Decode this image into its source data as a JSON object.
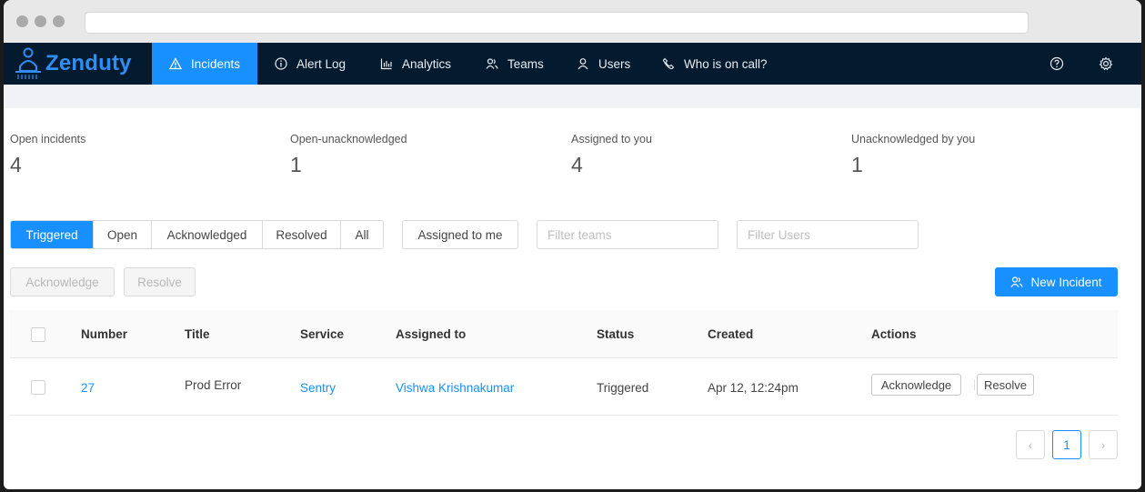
{
  "nav": {
    "brand": "Zenduty",
    "items": [
      {
        "label": "Incidents",
        "active": true
      },
      {
        "label": "Alert Log"
      },
      {
        "label": "Analytics"
      },
      {
        "label": "Teams"
      },
      {
        "label": "Users"
      },
      {
        "label": "Who is on call?"
      }
    ],
    "right_icons": [
      "help-icon",
      "gear-icon"
    ]
  },
  "stats": [
    {
      "label": "Open incidents",
      "value": "4"
    },
    {
      "label": "Open-unacknowledged",
      "value": "1"
    },
    {
      "label": "Assigned to you",
      "value": "4"
    },
    {
      "label": "Unacknowledged by you",
      "value": "1"
    }
  ],
  "filters": {
    "status_tabs": [
      "Triggered",
      "Open",
      "Acknowledged",
      "Resolved",
      "All"
    ],
    "active_tab": "Triggered",
    "assigned_to_me": "Assigned to me",
    "teams_placeholder": "Filter teams",
    "users_placeholder": "Filter Users"
  },
  "bulk_actions": {
    "acknowledge": "Acknowledge",
    "resolve": "Resolve",
    "new_incident": "New Incident"
  },
  "table": {
    "columns": [
      "Number",
      "Title",
      "Service",
      "Assigned to",
      "Status",
      "Created",
      "Actions"
    ],
    "rows": [
      {
        "number": "27",
        "title": "Prod Error",
        "service": "Sentry",
        "assigned_to": "Vishwa Krishnakumar",
        "status": "Triggered",
        "created": "Apr 12, 12:24pm",
        "actions": [
          "Acknowledge",
          "Resolve"
        ]
      }
    ]
  },
  "pagination": {
    "prev": "‹",
    "current": "1",
    "next": "›"
  },
  "colors": {
    "primary": "#1890ff",
    "nav_bg": "#041a2f",
    "brand": "#2f8ef5"
  }
}
